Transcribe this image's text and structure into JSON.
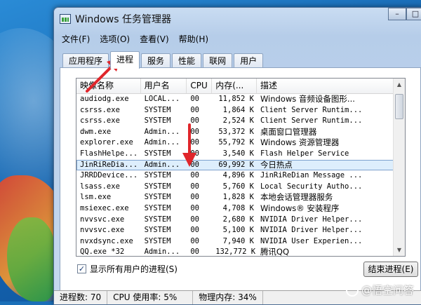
{
  "window": {
    "title": "Windows 任务管理器",
    "buttons": {
      "minimize": "–",
      "maximize": "□"
    }
  },
  "menu": [
    "文件(F)",
    "选项(O)",
    "查看(V)",
    "帮助(H)"
  ],
  "tabs": [
    "应用程序",
    "进程",
    "服务",
    "性能",
    "联网",
    "用户"
  ],
  "active_tab": "进程",
  "columns": {
    "image_name": "映像名称",
    "user_name": "用户名",
    "cpu": "CPU",
    "memory": "内存(...",
    "description": "描述"
  },
  "processes": [
    {
      "name": "audiodg.exe",
      "user": "LOCAL...",
      "cpu": "00",
      "mem": "11,852 K",
      "desc": "Windows 音频设备图形..."
    },
    {
      "name": "csrss.exe",
      "user": "SYSTEM",
      "cpu": "00",
      "mem": "1,864 K",
      "desc": "Client Server Runtim..."
    },
    {
      "name": "csrss.exe",
      "user": "SYSTEM",
      "cpu": "00",
      "mem": "2,524 K",
      "desc": "Client Server Runtim..."
    },
    {
      "name": "dwm.exe",
      "user": "Admin...",
      "cpu": "00",
      "mem": "53,372 K",
      "desc": "桌面窗口管理器"
    },
    {
      "name": "explorer.exe",
      "user": "Admin...",
      "cpu": "00",
      "mem": "55,792 K",
      "desc": "Windows 资源管理器"
    },
    {
      "name": "FlashHelpe...",
      "user": "SYSTEM",
      "cpu": "00",
      "mem": "3,540 K",
      "desc": "Flash Helper Service"
    },
    {
      "name": "JinRiReDia...",
      "user": "Admin...",
      "cpu": "00",
      "mem": "69,992 K",
      "desc": "今日热点"
    },
    {
      "name": "JRRDDevice...",
      "user": "SYSTEM",
      "cpu": "00",
      "mem": "4,896 K",
      "desc": "JinRiReDian Message ..."
    },
    {
      "name": "lsass.exe",
      "user": "SYSTEM",
      "cpu": "00",
      "mem": "5,760 K",
      "desc": "Local Security Autho..."
    },
    {
      "name": "lsm.exe",
      "user": "SYSTEM",
      "cpu": "00",
      "mem": "1,828 K",
      "desc": "本地会话管理器服务"
    },
    {
      "name": "msiexec.exe",
      "user": "SYSTEM",
      "cpu": "00",
      "mem": "4,708 K",
      "desc": "Windows® 安装程序"
    },
    {
      "name": "nvvsvc.exe",
      "user": "SYSTEM",
      "cpu": "00",
      "mem": "2,680 K",
      "desc": "NVIDIA Driver Helper..."
    },
    {
      "name": "nvvsvc.exe",
      "user": "SYSTEM",
      "cpu": "00",
      "mem": "5,100 K",
      "desc": "NVIDIA Driver Helper..."
    },
    {
      "name": "nvxdsync.exe",
      "user": "SYSTEM",
      "cpu": "00",
      "mem": "7,940 K",
      "desc": "NVIDIA User Experien..."
    },
    {
      "name": "QQ.exe *32",
      "user": "Admin...",
      "cpu": "00",
      "mem": "132,772 K",
      "desc": "腾讯QQ"
    }
  ],
  "selected_row": "JinRiReDia...",
  "show_all_processes": {
    "label": "显示所有用户的进程(S)",
    "checked": true,
    "mark": "✓"
  },
  "end_process_button": "结束进程(E)",
  "status": {
    "processes": "进程数: 70",
    "cpu": "CPU 使用率: 5%",
    "memory": "物理内存: 34%"
  },
  "watermark": "@悟空问答",
  "colors": {
    "arrow": "#e0262b",
    "selection": "#ddeefc"
  }
}
